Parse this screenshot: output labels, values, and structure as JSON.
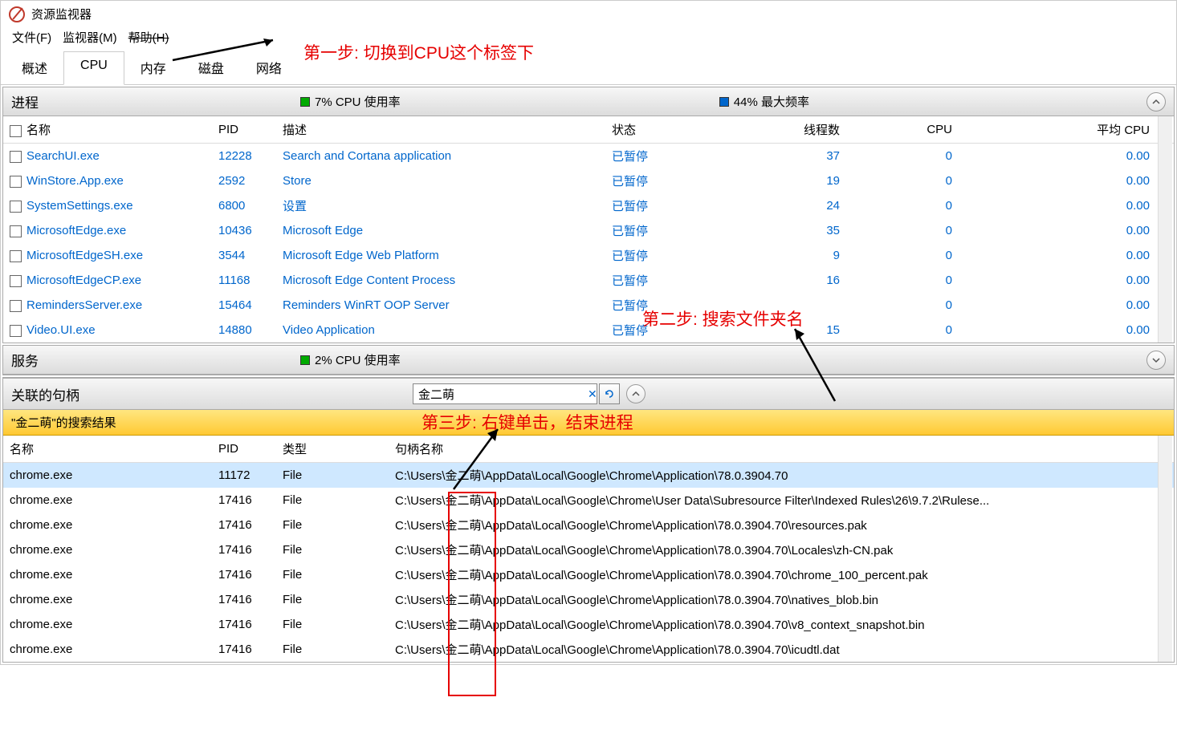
{
  "window": {
    "title": "资源监视器"
  },
  "menu": {
    "file": "文件(F)",
    "monitor": "监视器(M)",
    "help": "帮助(H)"
  },
  "tabs": {
    "overview": "概述",
    "cpu": "CPU",
    "memory": "内存",
    "disk": "磁盘",
    "network": "网络"
  },
  "annotations": {
    "step1": "第一步: 切换到CPU这个标签下",
    "step2": "第二步: 搜索文件夹名",
    "step3": "第三步: 右键单击，结束进程"
  },
  "processes": {
    "title": "进程",
    "cpu_usage": "7% CPU 使用率",
    "max_freq": "44% 最大频率",
    "cols": {
      "name": "名称",
      "pid": "PID",
      "desc": "描述",
      "status": "状态",
      "threads": "线程数",
      "cpu": "CPU",
      "avg": "平均 CPU"
    },
    "rows": [
      {
        "name": "SearchUI.exe",
        "pid": "12228",
        "desc": "Search and Cortana application",
        "status": "已暂停",
        "threads": "37",
        "cpu": "0",
        "avg": "0.00"
      },
      {
        "name": "WinStore.App.exe",
        "pid": "2592",
        "desc": "Store",
        "status": "已暂停",
        "threads": "19",
        "cpu": "0",
        "avg": "0.00"
      },
      {
        "name": "SystemSettings.exe",
        "pid": "6800",
        "desc": "设置",
        "status": "已暂停",
        "threads": "24",
        "cpu": "0",
        "avg": "0.00"
      },
      {
        "name": "MicrosoftEdge.exe",
        "pid": "10436",
        "desc": "Microsoft Edge",
        "status": "已暂停",
        "threads": "35",
        "cpu": "0",
        "avg": "0.00"
      },
      {
        "name": "MicrosoftEdgeSH.exe",
        "pid": "3544",
        "desc": "Microsoft Edge Web Platform",
        "status": "已暂停",
        "threads": "9",
        "cpu": "0",
        "avg": "0.00"
      },
      {
        "name": "MicrosoftEdgeCP.exe",
        "pid": "11168",
        "desc": "Microsoft Edge Content Process",
        "status": "已暂停",
        "threads": "16",
        "cpu": "0",
        "avg": "0.00"
      },
      {
        "name": "RemindersServer.exe",
        "pid": "15464",
        "desc": "Reminders WinRT OOP Server",
        "status": "已暂停",
        "threads": "",
        "cpu": "0",
        "avg": "0.00"
      },
      {
        "name": "Video.UI.exe",
        "pid": "14880",
        "desc": "Video Application",
        "status": "已暂停",
        "threads": "15",
        "cpu": "0",
        "avg": "0.00"
      }
    ]
  },
  "services": {
    "title": "服务",
    "cpu_usage": "2% CPU 使用率"
  },
  "handles": {
    "title": "关联的句柄",
    "search_value": "金二萌",
    "results_banner": "\"金二萌\"的搜索结果",
    "cols": {
      "name": "名称",
      "pid": "PID",
      "type": "类型",
      "handle": "句柄名称"
    },
    "username": "金二萌",
    "path_prefix": "C:\\Users\\",
    "rows": [
      {
        "name": "chrome.exe",
        "pid": "11172",
        "type": "File",
        "rest": "\\AppData\\Local\\Google\\Chrome\\Application\\78.0.3904.70"
      },
      {
        "name": "chrome.exe",
        "pid": "17416",
        "type": "File",
        "rest": "\\AppData\\Local\\Google\\Chrome\\User Data\\Subresource Filter\\Indexed Rules\\26\\9.7.2\\Rulese..."
      },
      {
        "name": "chrome.exe",
        "pid": "17416",
        "type": "File",
        "rest": "\\AppData\\Local\\Google\\Chrome\\Application\\78.0.3904.70\\resources.pak"
      },
      {
        "name": "chrome.exe",
        "pid": "17416",
        "type": "File",
        "rest": "\\AppData\\Local\\Google\\Chrome\\Application\\78.0.3904.70\\Locales\\zh-CN.pak"
      },
      {
        "name": "chrome.exe",
        "pid": "17416",
        "type": "File",
        "rest": "\\AppData\\Local\\Google\\Chrome\\Application\\78.0.3904.70\\chrome_100_percent.pak"
      },
      {
        "name": "chrome.exe",
        "pid": "17416",
        "type": "File",
        "rest": "\\AppData\\Local\\Google\\Chrome\\Application\\78.0.3904.70\\natives_blob.bin"
      },
      {
        "name": "chrome.exe",
        "pid": "17416",
        "type": "File",
        "rest": "\\AppData\\Local\\Google\\Chrome\\Application\\78.0.3904.70\\v8_context_snapshot.bin"
      },
      {
        "name": "chrome.exe",
        "pid": "17416",
        "type": "File",
        "rest": "\\AppData\\Local\\Google\\Chrome\\Application\\78.0.3904.70\\icudtl.dat"
      }
    ]
  }
}
